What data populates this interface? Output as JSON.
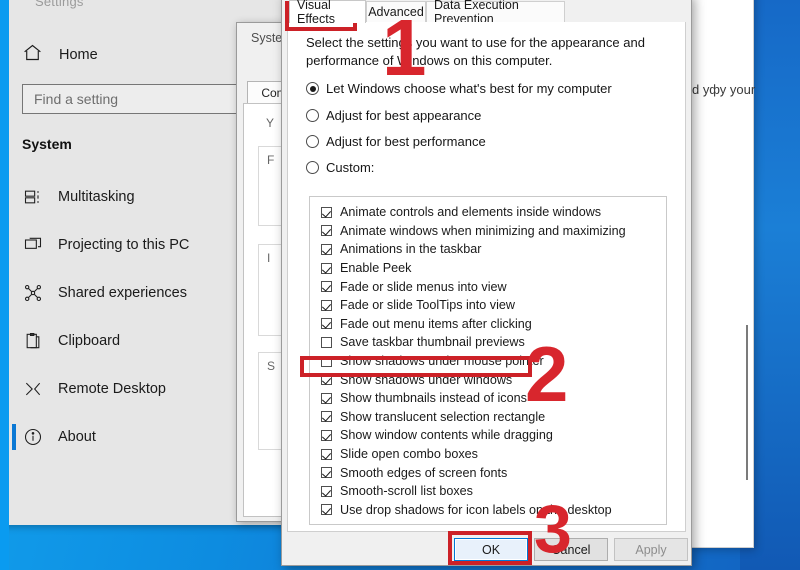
{
  "desktop": {
    "accent_color": "#0a9bf0"
  },
  "settings_window": {
    "title_partial": "Settings",
    "home_label": "Home",
    "search_placeholder": "Find a setting",
    "section_label": "System",
    "nav_items": [
      {
        "label": "Multitasking",
        "icon": "multitasking-icon",
        "selected": false
      },
      {
        "label": "Projecting to this PC",
        "icon": "projecting-icon",
        "selected": false
      },
      {
        "label": "Shared experiences",
        "icon": "shared-experiences-icon",
        "selected": false
      },
      {
        "label": "Clipboard",
        "icon": "clipboard-icon",
        "selected": false
      },
      {
        "label": "Remote Desktop",
        "icon": "remote-desktop-icon",
        "selected": false
      },
      {
        "label": "About",
        "icon": "info-icon",
        "selected": true
      }
    ]
  },
  "system_properties": {
    "title_partial": "Syste",
    "tab_partial": "Com",
    "ghost_labels": [
      "Y",
      "F",
      "I",
      "S"
    ]
  },
  "performance_options": {
    "tabs": [
      {
        "label": "Visual Effects",
        "active": true
      },
      {
        "label": "Advanced",
        "active": false
      },
      {
        "label": "Data Execution Prevention",
        "active": false
      }
    ],
    "intro_text": "Select the settings you want to use for the appearance and performance of Windows on this computer.",
    "radio_options": [
      {
        "label": "Let Windows choose what's best for my computer",
        "selected": true
      },
      {
        "label": "Adjust for best appearance",
        "selected": false
      },
      {
        "label": "Adjust for best performance",
        "selected": false
      },
      {
        "label": "Custom:",
        "selected": false
      }
    ],
    "checkbox_items": [
      {
        "label": "Animate controls and elements inside windows",
        "checked": true
      },
      {
        "label": "Animate windows when minimizing and maximizing",
        "checked": true
      },
      {
        "label": "Animations in the taskbar",
        "checked": true
      },
      {
        "label": "Enable Peek",
        "checked": true
      },
      {
        "label": "Fade or slide menus into view",
        "checked": true
      },
      {
        "label": "Fade or slide ToolTips into view",
        "checked": true
      },
      {
        "label": "Fade out menu items after clicking",
        "checked": true
      },
      {
        "label": "Save taskbar thumbnail previews",
        "checked": false
      },
      {
        "label": "Show shadows under mouse pointer",
        "checked": false
      },
      {
        "label": "Show shadows under windows",
        "checked": true
      },
      {
        "label": "Show thumbnails instead of icons",
        "checked": true
      },
      {
        "label": "Show translucent selection rectangle",
        "checked": true
      },
      {
        "label": "Show window contents while dragging",
        "checked": true
      },
      {
        "label": "Slide open combo boxes",
        "checked": true
      },
      {
        "label": "Smooth edges of screen fonts",
        "checked": true
      },
      {
        "label": "Smooth-scroll list boxes",
        "checked": true
      },
      {
        "label": "Use drop shadows for icon labels on the desktop",
        "checked": true
      }
    ],
    "buttons": {
      "ok": "OK",
      "cancel": "Cancel",
      "apply": "Apply"
    }
  },
  "background_window": {
    "partial_text": "d уфу your"
  },
  "annotations": {
    "color": "#cc2127",
    "steps": [
      {
        "number": "1",
        "target": "visual-effects-tab"
      },
      {
        "number": "2",
        "target": "show-thumbnails-instead-of-icons-checkbox"
      },
      {
        "number": "3",
        "target": "ok-button"
      }
    ]
  }
}
